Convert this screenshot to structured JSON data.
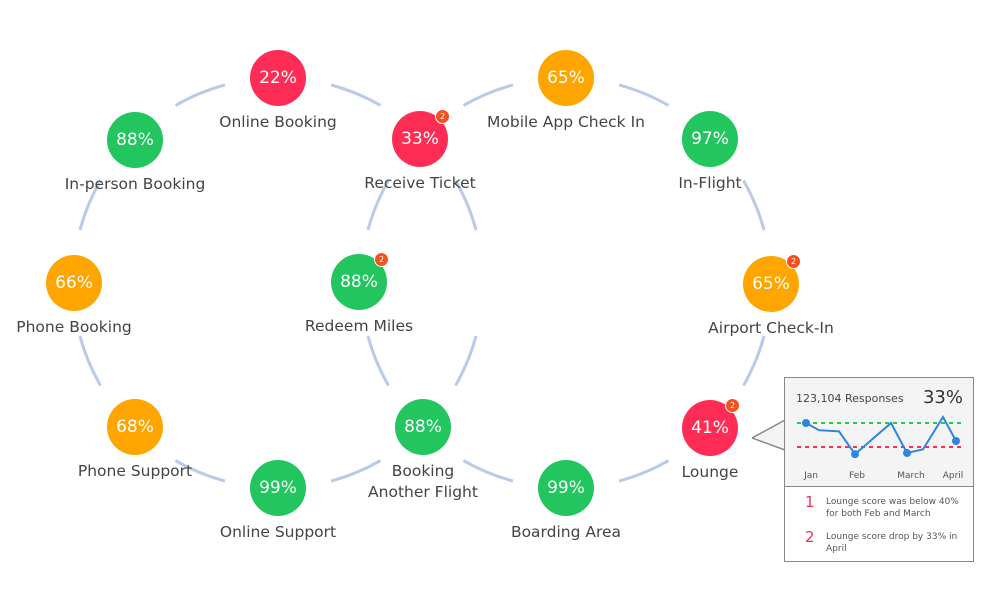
{
  "colors": {
    "green": "#22c55e",
    "red": "#ff2d55",
    "orange": "#ffa500",
    "ring": "#b9cbe6",
    "good_line": "#22cc44",
    "bad_line": "#ff2d55",
    "line": "#2f86de"
  },
  "nodes": [
    {
      "label": "Online Booking",
      "value": "22%",
      "status": "red"
    },
    {
      "label": "In-person Booking",
      "value": "88%",
      "status": "green"
    },
    {
      "label": "Phone Booking",
      "value": "66%",
      "status": "orange"
    },
    {
      "label": "Phone Support",
      "value": "68%",
      "status": "orange"
    },
    {
      "label": "Online Support",
      "value": "99%",
      "status": "green"
    },
    {
      "label": "Booking\nAnother Flight",
      "value": "88%",
      "status": "green"
    },
    {
      "label": "Redeem Miles",
      "value": "88%",
      "status": "green",
      "badge": "2"
    },
    {
      "label": "Receive Ticket",
      "value": "33%",
      "status": "red",
      "badge": "2"
    },
    {
      "label": "Mobile App Check In",
      "value": "65%",
      "status": "orange"
    },
    {
      "label": "In-Flight",
      "value": "97%",
      "status": "green"
    },
    {
      "label": "Airport Check-In",
      "value": "65%",
      "status": "orange",
      "badge": "2"
    },
    {
      "label": "Lounge",
      "value": "41%",
      "status": "red",
      "badge": "2"
    },
    {
      "label": "Boarding Area",
      "value": "99%",
      "status": "green"
    }
  ],
  "tooltip": {
    "responses": "123,104 Responses",
    "score": "33%",
    "chart_data": {
      "type": "line",
      "months": [
        "Jan",
        "Feb",
        "March",
        "April"
      ],
      "values": [
        60,
        54,
        53,
        34,
        60,
        35,
        38,
        65,
        45
      ],
      "markers": [
        0,
        3,
        5,
        8
      ],
      "good_threshold": 60,
      "bad_threshold": 40
    },
    "notes": [
      {
        "num": "1",
        "text": "Lounge score was below 40% for both Feb and March"
      },
      {
        "num": "2",
        "text": "Lounge score drop by 33% in April"
      }
    ]
  }
}
